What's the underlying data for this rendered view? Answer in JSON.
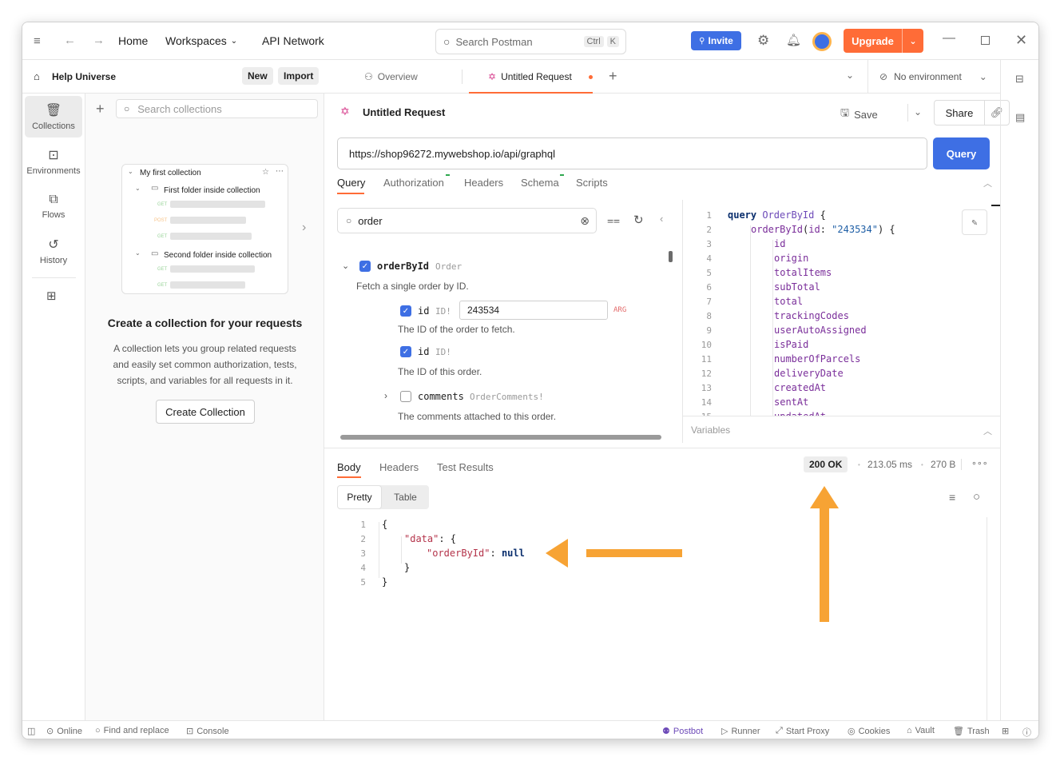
{
  "topbar": {
    "home": "Home",
    "workspaces": "Workspaces",
    "api_network": "API Network",
    "search_placeholder": "Search Postman",
    "kbd_ctrl": "Ctrl",
    "kbd_k": "K",
    "invite": "Invite",
    "upgrade": "Upgrade"
  },
  "workspace": {
    "name": "Help Universe",
    "new_label": "New",
    "import_label": "Import"
  },
  "rail": [
    {
      "label": "Collections",
      "icon": "collections-icon"
    },
    {
      "label": "Environments",
      "icon": "environments-icon"
    },
    {
      "label": "Flows",
      "icon": "flows-icon"
    },
    {
      "label": "History",
      "icon": "history-icon"
    }
  ],
  "collections_panel": {
    "search_placeholder": "Search collections",
    "preview_title": "My first collection",
    "folder1": "First folder inside collection",
    "folder2": "Second folder inside collection",
    "method_get": "GET",
    "method_post": "POST",
    "empty_title": "Create a collection for your requests",
    "empty_desc_1": "A collection lets you group related requests",
    "empty_desc_2": "and easily set common authorization, tests,",
    "empty_desc_3": "scripts, and variables for all requests in it.",
    "create_button": "Create Collection"
  },
  "tabs": {
    "overview": "Overview",
    "untitled": "Untitled Request",
    "environment": "No environment"
  },
  "request": {
    "title": "Untitled Request",
    "save": "Save",
    "share": "Share",
    "url": "https://shop96272.mywebshop.io/api/graphql",
    "query_button": "Query",
    "subtabs": [
      "Query",
      "Authorization",
      "Headers",
      "Schema",
      "Scripts"
    ]
  },
  "explorer": {
    "filter_value": "order",
    "root_field": "orderById",
    "root_type": "Order",
    "root_desc": "Fetch a single order by ID.",
    "arg_name": "id",
    "arg_type": "ID!",
    "arg_value": "243534",
    "arg_badge": "ARG",
    "arg_desc": "The ID of the order to fetch.",
    "id_name": "id",
    "id_type": "ID!",
    "id_desc": "The ID of this order.",
    "comments_name": "comments",
    "comments_type": "OrderComments!",
    "comments_desc": "The comments attached to this order."
  },
  "editor": {
    "line1_kw": "query",
    "line1_name": "OrderById",
    "line2_field": "orderById",
    "line2_arg": "id",
    "line2_value": "\"243534\"",
    "fields": [
      "id",
      "origin",
      "totalItems",
      "subTotal",
      "total",
      "trackingCodes",
      "userAutoAssigned",
      "isPaid",
      "numberOfParcels",
      "deliveryDate",
      "createdAt",
      "sentAt",
      "updatedAt"
    ],
    "variables_label": "Variables"
  },
  "response": {
    "tabs": [
      "Body",
      "Headers",
      "Test Results"
    ],
    "status": "200 OK",
    "time": "213.05 ms",
    "size": "270 B",
    "pretty": "Pretty",
    "table": "Table",
    "json_key_data": "\"data\"",
    "json_key_order": "\"orderById\"",
    "json_null": "null"
  },
  "statusbar": {
    "online": "Online",
    "find_replace": "Find and replace",
    "console": "Console",
    "postbot": "Postbot",
    "runner": "Runner",
    "start_proxy": "Start Proxy",
    "cookies": "Cookies",
    "vault": "Vault",
    "trash": "Trash"
  },
  "colors": {
    "accent": "#ff6c37",
    "primary": "#3e6fe4",
    "annotation": "#f7a334"
  }
}
